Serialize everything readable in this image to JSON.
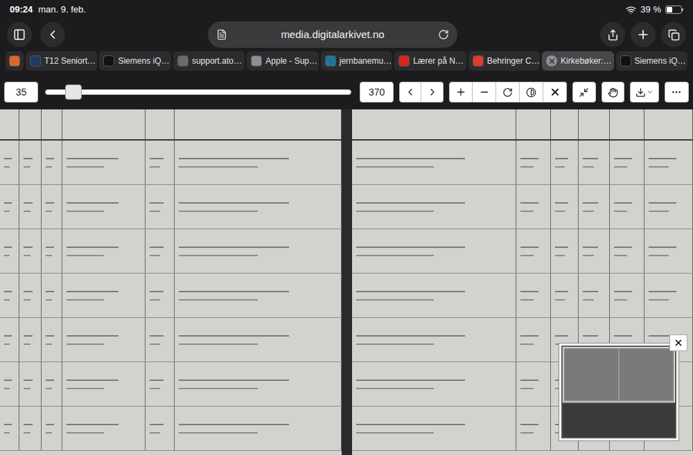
{
  "status_bar": {
    "time": "09:24",
    "date": "man. 9. feb.",
    "battery": "39 %",
    "battery_level": 0.39,
    "wifi": true
  },
  "address_bar": {
    "url": "media.digitalarkivet.no"
  },
  "tabs": [
    {
      "kind": "pinned",
      "label": "",
      "selected": false,
      "color": "#e0662a"
    },
    {
      "kind": "tab",
      "label": "T12 Seniort…",
      "selected": false,
      "color": "#1f3b63"
    },
    {
      "kind": "tab",
      "label": "Siemens iQ…",
      "selected": false,
      "color": "#111111"
    },
    {
      "kind": "tab",
      "label": "support.ato…",
      "selected": false,
      "color": "#6b6b6b"
    },
    {
      "kind": "tab",
      "label": "Apple - Sup…",
      "selected": false,
      "color": "#8e8e93"
    },
    {
      "kind": "tab",
      "label": "jernbanemu…",
      "selected": false,
      "color": "#21759b"
    },
    {
      "kind": "tab",
      "label": "Lærer på N…",
      "selected": false,
      "color": "#d9261c"
    },
    {
      "kind": "tab",
      "label": "Behringer C…",
      "selected": false,
      "color": "#e03a2f"
    },
    {
      "kind": "tab",
      "label": "Kirkebøker:…",
      "selected": true,
      "color": "#9a9a9a"
    },
    {
      "kind": "tab",
      "label": "Siemens iQ…",
      "selected": false,
      "color": "#111111"
    }
  ],
  "viewer": {
    "page": "35",
    "total": "370",
    "level": 0.092
  },
  "minimap": {
    "visible": true
  }
}
